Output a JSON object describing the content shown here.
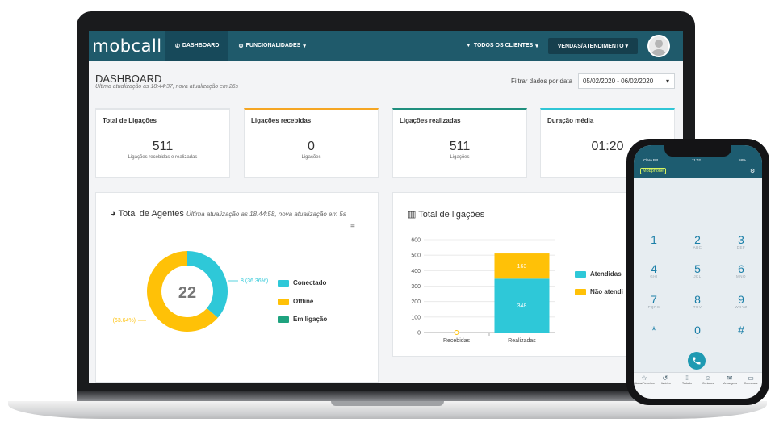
{
  "app": {
    "logo": "mobcall"
  },
  "nav": {
    "dashboard": "DASHBOARD",
    "features": "FUNCIONALIDADES",
    "clients_filter": "TODOS OS CLIENTES",
    "sales_button": "VENDAS/ATENDIMENTO"
  },
  "header": {
    "title": "DASHBOARD",
    "subtitle": "Última atualização às 18:44:37, nova atualização em 26s",
    "filter_label": "Filtrar dados por data",
    "date_range": "05/02/2020 - 06/02/2020"
  },
  "cards": [
    {
      "title": "Total de Ligações",
      "value": "511",
      "caption": "Ligações recebidas e realizadas",
      "accent": "#e2e5e8"
    },
    {
      "title": "Ligações recebidas",
      "value": "0",
      "caption": "Ligações",
      "accent": "#f5a623"
    },
    {
      "title": "Ligações realizadas",
      "value": "511",
      "caption": "Ligações",
      "accent": "#1f8f7e"
    },
    {
      "title": "Duração média",
      "value": "01:20",
      "caption": "",
      "accent": "#30c6d6"
    }
  ],
  "agents_panel": {
    "title": "Total de Agentes",
    "subtitle": "Última atualização as 18:44:58, nova atualização em 5s",
    "total": "22",
    "label_connected": "8 (36.36%)",
    "label_offline": "(63.64%)",
    "legend": [
      "Conectado",
      "Offline",
      "Em ligação"
    ]
  },
  "calls_panel": {
    "title": "Total de ligações",
    "legend": [
      "Atendidas",
      "Não atendi"
    ]
  },
  "colors": {
    "connected": "#2ec8d8",
    "offline": "#ffc107",
    "in_call": "#1fa37f",
    "answered": "#2ec8d8",
    "unanswered": "#ffc107",
    "topbar": "#1f5a6b"
  },
  "chart_data": [
    {
      "type": "pie",
      "categories": [
        "Conectado",
        "Offline",
        "Em ligação"
      ],
      "values": [
        8,
        14,
        0
      ],
      "center_label": "22"
    },
    {
      "type": "bar",
      "stacked": true,
      "categories": [
        "Recebidas",
        "Realizadas"
      ],
      "series": [
        {
          "name": "Atendidas",
          "values": [
            0,
            348
          ]
        },
        {
          "name": "Não atendi",
          "values": [
            0,
            163
          ]
        }
      ],
      "ylim": [
        0,
        600
      ],
      "yticks": [
        0,
        100,
        200,
        300,
        400,
        500,
        600
      ]
    }
  ],
  "phone": {
    "carrier": "Claro BR",
    "time": "11:02",
    "battery": "58%",
    "brand": "Mobphone",
    "keys": [
      {
        "digit": "1",
        "letters": ""
      },
      {
        "digit": "2",
        "letters": "ABC"
      },
      {
        "digit": "3",
        "letters": "DEF"
      },
      {
        "digit": "4",
        "letters": "GHI"
      },
      {
        "digit": "5",
        "letters": "JKL"
      },
      {
        "digit": "6",
        "letters": "MNO"
      },
      {
        "digit": "7",
        "letters": "PQRS"
      },
      {
        "digit": "8",
        "letters": "TUV"
      },
      {
        "digit": "9",
        "letters": "WXYZ"
      },
      {
        "digit": "*",
        "letters": ""
      },
      {
        "digit": "0",
        "letters": "+"
      },
      {
        "digit": "#",
        "letters": ""
      }
    ],
    "tabs": [
      "Status/Favoritos",
      "Histórico",
      "Teclado",
      "Contatos",
      "Mensagens",
      "Conversas"
    ]
  }
}
